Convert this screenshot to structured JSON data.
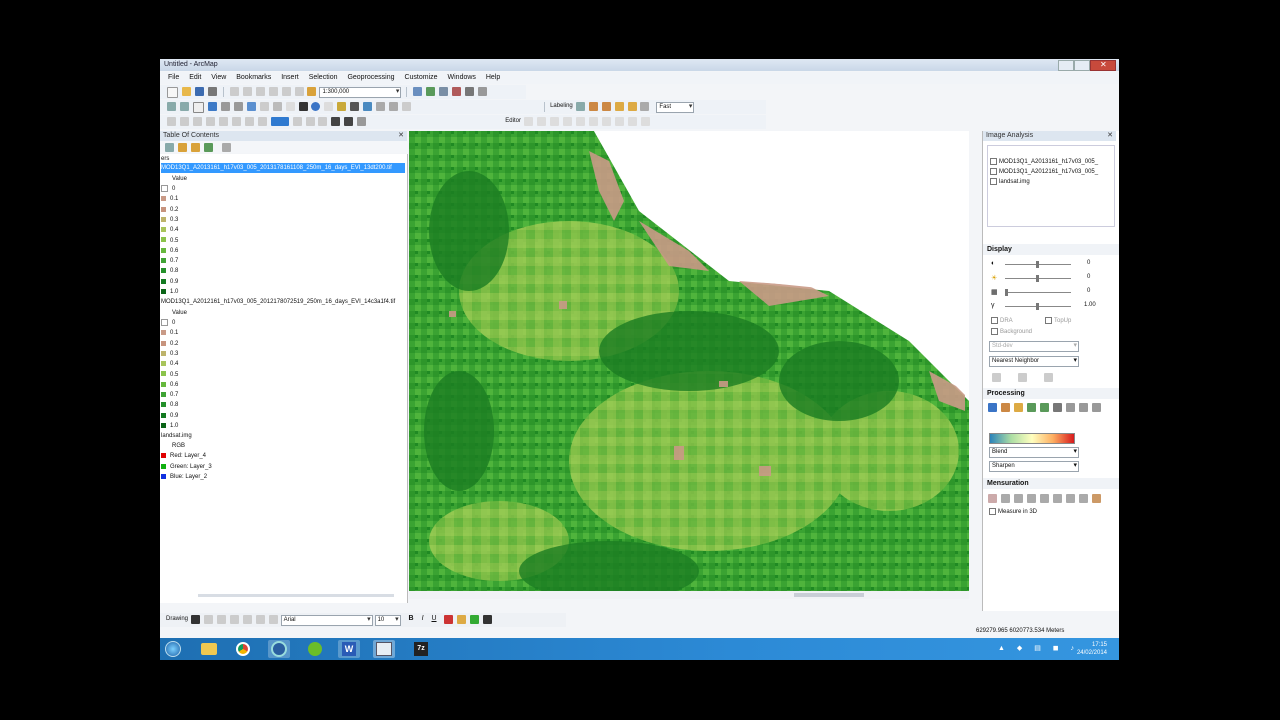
{
  "window": {
    "title": "Untitled - ArcMap"
  },
  "menu": [
    "File",
    "Edit",
    "View",
    "Bookmarks",
    "Insert",
    "Selection",
    "Geoprocessing",
    "Customize",
    "Windows",
    "Help"
  ],
  "toolbar": {
    "scale": "1:300,000",
    "labeling": "Labeling",
    "editor": "Editor",
    "quality": "Fast"
  },
  "toc": {
    "title": "Table Of Contents",
    "layers_label": "ers",
    "layer1": "MOD13Q1_A2013161_h17v03_005_2013178161108_250m_16_days_EVI_13dt200.tif",
    "layer2": "MOD13Q1_A2012161_h17v03_005_2012178072519_250m_16_days_EVI_14c3a1f4.tif",
    "value_label": "Value",
    "classes": [
      "0",
      "0.1",
      "0.2",
      "0.3",
      "0.4",
      "0.5",
      "0.6",
      "0.7",
      "0.8",
      "0.9",
      "1.0"
    ],
    "class_colors": [
      "#ffffff",
      "#c99a86",
      "#c7937d",
      "#bdb36a",
      "#a8c45a",
      "#8bc34a",
      "#66b83c",
      "#3fa334",
      "#24902a",
      "#137a21",
      "#0a6417"
    ],
    "landsat": "landsat.img",
    "rgb": "RGB",
    "red": "Red:   Layer_4",
    "green": "Green: Layer_3",
    "blue": "Blue:  Layer_2"
  },
  "image_analysis": {
    "title": "Image Analysis",
    "layers": [
      "MOD13Q1_A2013161_h17v03_005_",
      "MOD13Q1_A2012161_h17v03_005_",
      "landsat.img"
    ],
    "display": "Display",
    "slider_values": [
      "0",
      "0",
      "0",
      "1.00"
    ],
    "dra": "DRA",
    "topup": "TopUp",
    "background": "Background",
    "stretch": "Std-dev",
    "resampling": "Nearest Neighbor",
    "processing": "Processing",
    "blend": "Blend",
    "sharpen": "Sharpen",
    "mensuration": "Mensuration",
    "measure3d": "Measure in 3D"
  },
  "drawing": {
    "label": "Drawing",
    "font": "Arial",
    "size": "10"
  },
  "status": {
    "coords": "629279.965  6020773.534 Meters"
  },
  "clock": {
    "time": "17:15",
    "date": "24/02/2014"
  }
}
